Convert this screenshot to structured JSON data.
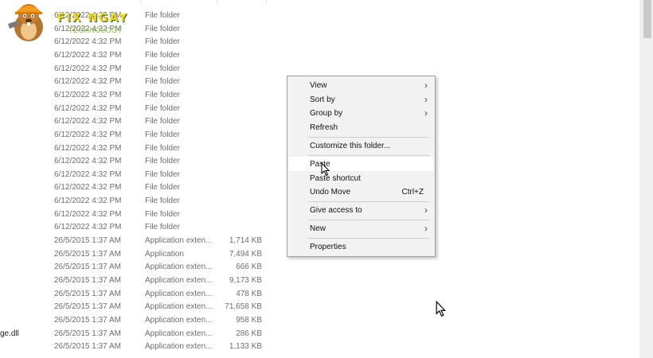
{
  "logo": {
    "word": "FIX NGAY",
    "sub": "TECHNOLOGY"
  },
  "file_rows": [
    {
      "date": "6/12/2022 4:32 PM",
      "type": "File folder",
      "size": ""
    },
    {
      "date": "6/12/2022 4:32 PM",
      "type": "File folder",
      "size": ""
    },
    {
      "date": "6/12/2022 4:32 PM",
      "type": "File folder",
      "size": ""
    },
    {
      "date": "6/12/2022 4:32 PM",
      "type": "File folder",
      "size": ""
    },
    {
      "date": "6/12/2022 4:32 PM",
      "type": "File folder",
      "size": ""
    },
    {
      "date": "6/12/2022 4:32 PM",
      "type": "File folder",
      "size": ""
    },
    {
      "date": "6/12/2022 4:32 PM",
      "type": "File folder",
      "size": ""
    },
    {
      "date": "6/12/2022 4:32 PM",
      "type": "File folder",
      "size": ""
    },
    {
      "date": "6/12/2022 4:32 PM",
      "type": "File folder",
      "size": ""
    },
    {
      "date": "6/12/2022 4:32 PM",
      "type": "File folder",
      "size": ""
    },
    {
      "date": "6/12/2022 4:32 PM",
      "type": "File folder",
      "size": ""
    },
    {
      "date": "6/12/2022 4:32 PM",
      "type": "File folder",
      "size": ""
    },
    {
      "date": "6/12/2022 4:32 PM",
      "type": "File folder",
      "size": ""
    },
    {
      "date": "6/12/2022 4:32 PM",
      "type": "File folder",
      "size": ""
    },
    {
      "date": "6/12/2022 4:32 PM",
      "type": "File folder",
      "size": ""
    },
    {
      "date": "6/12/2022 4:32 PM",
      "type": "File folder",
      "size": ""
    },
    {
      "date": "6/12/2022 4:32 PM",
      "type": "File folder",
      "size": ""
    },
    {
      "date": "26/5/2015 1:37 AM",
      "type": "Application exten...",
      "size": "1,714 KB"
    },
    {
      "date": "26/5/2015 1:37 AM",
      "type": "Application",
      "size": "7,494 KB"
    },
    {
      "date": "26/5/2015 1:37 AM",
      "type": "Application exten...",
      "size": "666 KB"
    },
    {
      "date": "26/5/2015 1:37 AM",
      "type": "Application exten...",
      "size": "9,173 KB"
    },
    {
      "date": "26/5/2015 1:37 AM",
      "type": "Application exten...",
      "size": "478 KB"
    },
    {
      "date": "26/5/2015 1:37 AM",
      "type": "Application exten...",
      "size": "71,658 KB"
    },
    {
      "date": "26/5/2015 1:37 AM",
      "type": "Application exten...",
      "size": "958 KB"
    },
    {
      "date": "26/5/2015 1:37 AM",
      "type": "Application exten...",
      "size": "286 KB"
    },
    {
      "date": "26/5/2015 1:37 AM",
      "type": "Application exten...",
      "size": "1,133 KB"
    }
  ],
  "edge_filename": "ge.dll",
  "context_menu": {
    "view": "View",
    "sort_by": "Sort by",
    "group_by": "Group by",
    "refresh": "Refresh",
    "customize": "Customize this folder...",
    "paste": "Paste",
    "paste_shortcut": "Paste shortcut",
    "undo_move": "Undo Move",
    "undo_shortcut": "Ctrl+Z",
    "give_access": "Give access to",
    "new": "New",
    "properties": "Properties",
    "submenu_arrow": "›"
  }
}
